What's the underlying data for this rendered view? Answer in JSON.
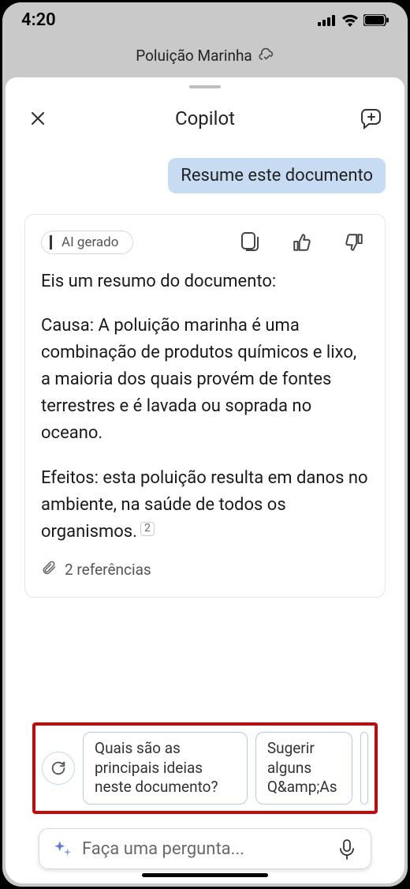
{
  "status": {
    "time": "4:20"
  },
  "app_header": {
    "title": "Poluição Marinha"
  },
  "sheet": {
    "title": "Copilot"
  },
  "chat": {
    "user_message": "Resume este documento",
    "ai_chip": "AI gerado",
    "ai_intro": "Eis um resumo do documento:",
    "ai_p1": "Causa: A poluição marinha é uma combinação de produtos químicos e lixo, a maioria dos quais provém de fontes terrestres e é lavada ou soprada no oceano.",
    "ai_p2": "Efeitos: esta poluição resulta em danos no ambiente, na saúde de todos os organismos.",
    "ref_inline": "2",
    "references": "2 referências"
  },
  "suggestions": {
    "s1": "Quais são as principais ideias neste documento?",
    "s2": "Sugerir alguns Q&amp;As"
  },
  "input": {
    "placeholder": "Faça uma pergunta..."
  }
}
